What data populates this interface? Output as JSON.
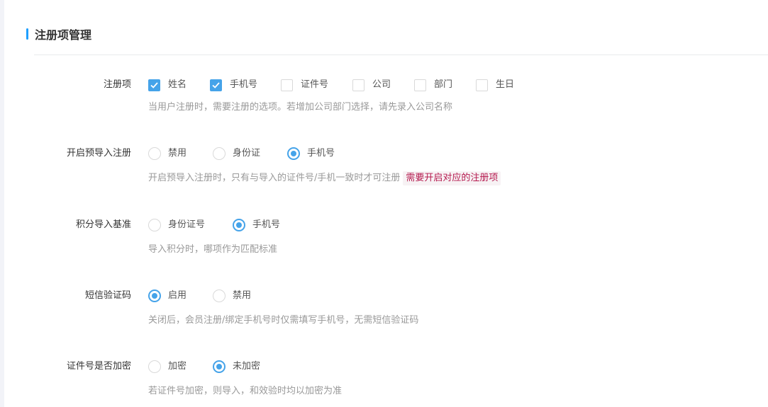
{
  "section": {
    "title": "注册项管理"
  },
  "colors": {
    "accent": "#45a3e9",
    "title_bar": "#1e9fff",
    "hint_tag_text": "#b5194e"
  },
  "register_items": {
    "label": "注册项",
    "options": [
      {
        "label": "姓名",
        "checked": true
      },
      {
        "label": "手机号",
        "checked": true
      },
      {
        "label": "证件号",
        "checked": false
      },
      {
        "label": "公司",
        "checked": false
      },
      {
        "label": "部门",
        "checked": false
      },
      {
        "label": "生日",
        "checked": false
      }
    ],
    "hint": "当用户注册时，需要注册的选项。若增加公司部门选择，请先录入公司名称"
  },
  "pre_import": {
    "label": "开启预导入注册",
    "options": [
      {
        "label": "禁用",
        "selected": false
      },
      {
        "label": "身份证",
        "selected": false
      },
      {
        "label": "手机号",
        "selected": true
      }
    ],
    "hint": "开启预导入注册时，只有与导入的证件号/手机一致时才可注册",
    "hint_tag": "需要开启对应的注册项"
  },
  "points_import": {
    "label": "积分导入基准",
    "options": [
      {
        "label": "身份证号",
        "selected": false
      },
      {
        "label": "手机号",
        "selected": true
      }
    ],
    "hint": "导入积分时，哪项作为匹配标准"
  },
  "sms_code": {
    "label": "短信验证码",
    "options": [
      {
        "label": "启用",
        "selected": true
      },
      {
        "label": "禁用",
        "selected": false
      }
    ],
    "hint": "关闭后，会员注册/绑定手机号时仅需填写手机号，无需短信验证码"
  },
  "id_encrypt": {
    "label": "证件号是否加密",
    "options": [
      {
        "label": "加密",
        "selected": false
      },
      {
        "label": "未加密",
        "selected": true
      }
    ],
    "hint": "若证件号加密，则导入，和效验时均以加密为准"
  }
}
